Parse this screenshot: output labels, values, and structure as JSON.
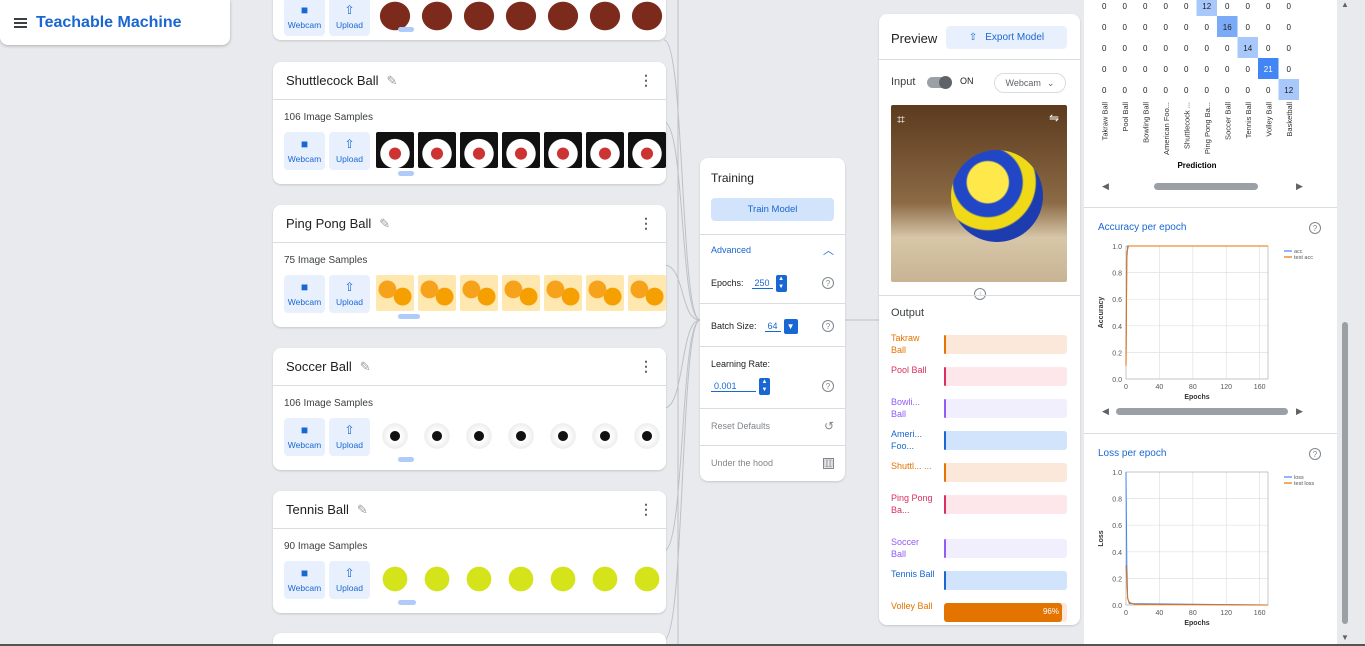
{
  "app": {
    "title": "Teachable Machine"
  },
  "common": {
    "webcam": "Webcam",
    "upload": "Upload"
  },
  "classes": [
    {
      "name": "Shuttlecock Ball",
      "count": "106 Image Samples"
    },
    {
      "name": "Ping Pong Ball",
      "count": "75 Image Samples"
    },
    {
      "name": "Soccer Ball",
      "count": "106 Image Samples"
    },
    {
      "name": "Tennis Ball",
      "count": "90 Image Samples"
    }
  ],
  "training": {
    "title": "Training",
    "train_button": "Train Model",
    "advanced": "Advanced",
    "epochs_label": "Epochs:",
    "epochs_value": "250",
    "batch_label": "Batch Size:",
    "batch_value": "64",
    "lr_label": "Learning Rate:",
    "lr_value": "0.001",
    "reset": "Reset Defaults",
    "under_hood": "Under the hood",
    "help": "?"
  },
  "preview": {
    "title": "Preview",
    "export": "Export Model",
    "input_label": "Input",
    "toggle_state": "ON",
    "source": "Webcam",
    "output_label": "Output",
    "outputs": [
      {
        "label": "Takraw Ball",
        "color": "#e37400",
        "bg": "#fce8db",
        "value": 0
      },
      {
        "label": "Pool Ball",
        "color": "#d93060",
        "bg": "#fde7eb",
        "value": 0
      },
      {
        "label": "Bowli... Ball",
        "color": "#8f5cf7",
        "bg": "#f1effd",
        "value": 0
      },
      {
        "label": "Ameri... Foo...",
        "color": "#1967d2",
        "bg": "#d2e3fc",
        "value": 0
      },
      {
        "label": "Shuttl... ...",
        "color": "#e37400",
        "bg": "#fce8db",
        "value": 0
      },
      {
        "label": "Ping Pong Ba...",
        "color": "#d93060",
        "bg": "#fde7eb",
        "value": 0
      },
      {
        "label": "Soccer Ball",
        "color": "#8f5cf7",
        "bg": "#f1effd",
        "value": 0
      },
      {
        "label": "Tennis Ball",
        "color": "#1967d2",
        "bg": "#d2e3fc",
        "value": 0
      },
      {
        "label": "Volley Ball",
        "color": "#e37400",
        "bg": "#fce8db",
        "value": 96,
        "text": "96%"
      }
    ]
  },
  "confusion": {
    "rows": [
      [
        0,
        0,
        0,
        0,
        0,
        12,
        0,
        0,
        0,
        0
      ],
      [
        0,
        0,
        0,
        0,
        0,
        0,
        16,
        0,
        0,
        0
      ],
      [
        0,
        0,
        0,
        0,
        0,
        0,
        0,
        14,
        0,
        0
      ],
      [
        0,
        0,
        0,
        0,
        0,
        0,
        0,
        0,
        21,
        0
      ],
      [
        0,
        0,
        0,
        0,
        0,
        0,
        0,
        0,
        0,
        12
      ]
    ],
    "column_labels": [
      "Takraw Ball",
      "Pool Ball",
      "Bowling Ball",
      "American Foo...",
      "Shuttlecock ...",
      "Ping Pong Ba...",
      "Soccer Ball",
      "Tennis Ball",
      "Volley Ball",
      "Basketball"
    ],
    "xlabel": "Prediction"
  },
  "chart_data": [
    {
      "type": "line",
      "title": "Accuracy per epoch",
      "xlabel": "Epochs",
      "ylabel": "Accuracy",
      "xlim": [
        0,
        170
      ],
      "ylim": [
        0,
        1
      ],
      "xticks": [
        "0",
        "40",
        "80",
        "120",
        "160"
      ],
      "yticks": [
        "0.0",
        "0.2",
        "0.4",
        "0.6",
        "0.8",
        "1.0"
      ],
      "series": [
        {
          "name": "acc",
          "color": "#4285f4",
          "x": [
            0,
            1,
            2,
            5,
            170
          ],
          "y": [
            0.1,
            0.9,
            1.0,
            1.0,
            1.0
          ]
        },
        {
          "name": "test acc",
          "color": "#e8710a",
          "x": [
            0,
            1,
            3,
            6,
            170
          ],
          "y": [
            0.1,
            0.95,
            1.0,
            1.0,
            1.0
          ]
        }
      ]
    },
    {
      "type": "line",
      "title": "Loss per epoch",
      "xlabel": "Epochs",
      "ylabel": "Loss",
      "xlim": [
        0,
        170
      ],
      "ylim": [
        0,
        1
      ],
      "xticks": [
        "0",
        "40",
        "80",
        "120",
        "160"
      ],
      "yticks": [
        "0.0",
        "0.2",
        "0.4",
        "0.6",
        "0.8",
        "1.0"
      ],
      "series": [
        {
          "name": "loss",
          "color": "#4285f4",
          "x": [
            0,
            1,
            2,
            4,
            170
          ],
          "y": [
            1.0,
            0.3,
            0.05,
            0.01,
            0.0
          ]
        },
        {
          "name": "test loss",
          "color": "#e8710a",
          "x": [
            0,
            2,
            4,
            10,
            170
          ],
          "y": [
            0.3,
            0.05,
            0.02,
            0.005,
            0.0
          ]
        }
      ]
    }
  ]
}
